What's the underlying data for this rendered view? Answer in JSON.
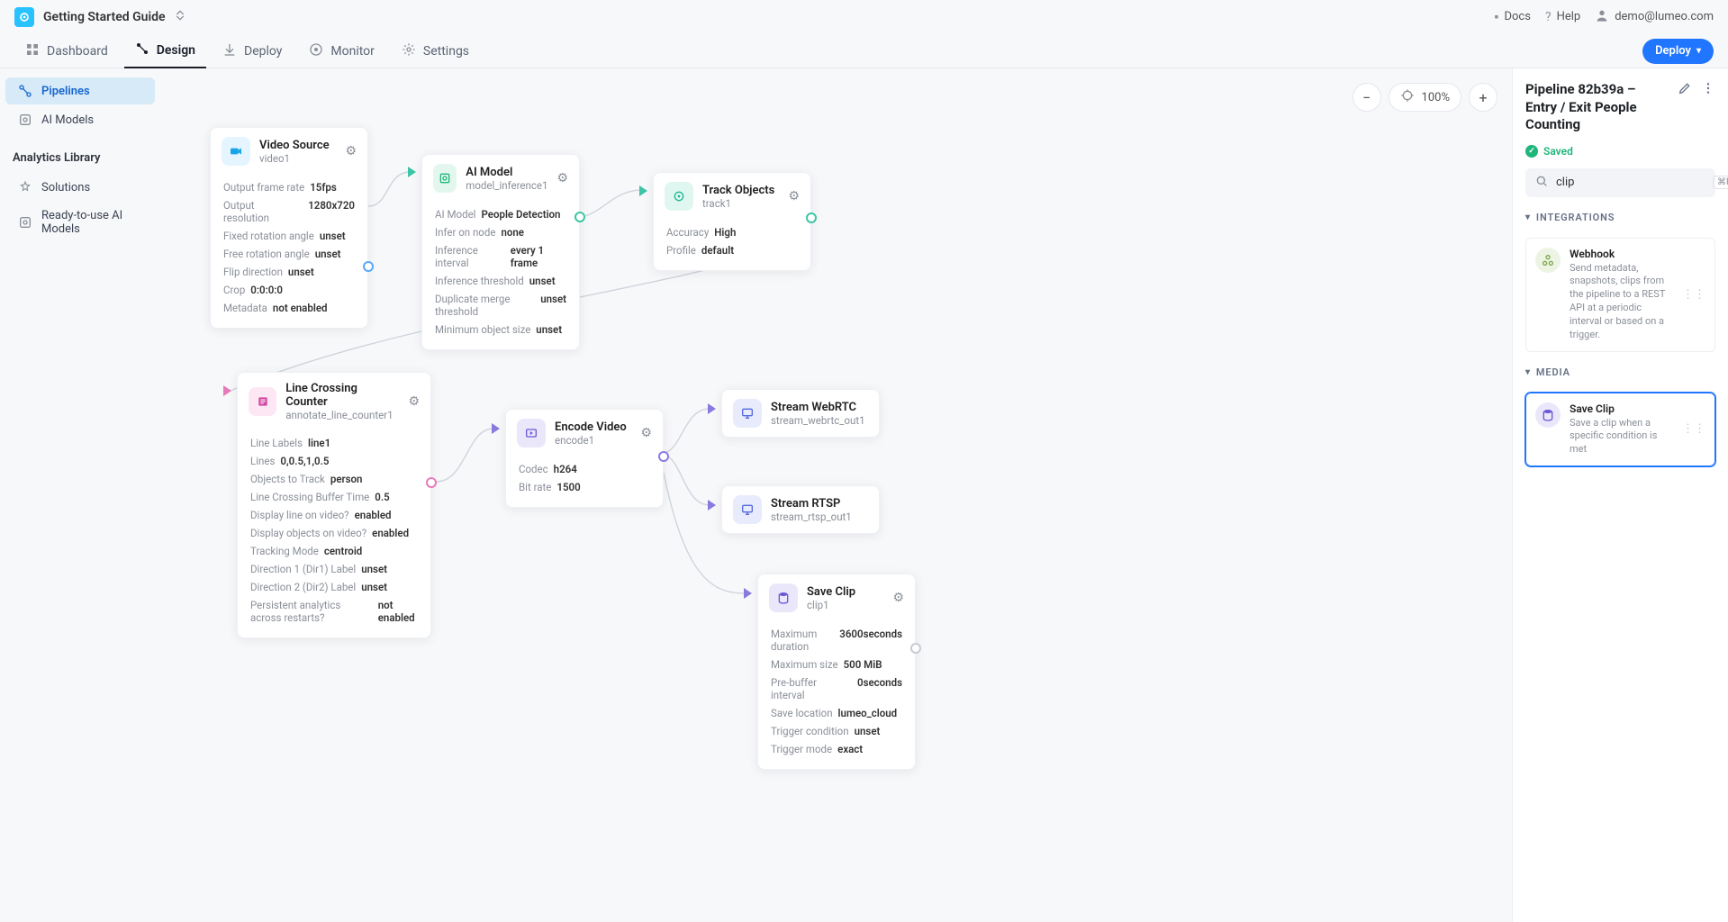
{
  "project_name": "Getting Started Guide",
  "top_links": {
    "docs": "Docs",
    "help": "Help",
    "user": "demo@lumeo.com"
  },
  "tabs": {
    "dashboard": "Dashboard",
    "design": "Design",
    "deploy": "Deploy",
    "monitor": "Monitor",
    "settings": "Settings"
  },
  "deploy_btn": "Deploy",
  "sidebar": {
    "pipelines": "Pipelines",
    "ai_models": "AI Models",
    "library_heading": "Analytics Library",
    "solutions": "Solutions",
    "ready_models": "Ready-to-use AI Models"
  },
  "zoom": {
    "level": "100%"
  },
  "nodes": {
    "video_source": {
      "title": "Video Source",
      "sub": "video1",
      "props": [
        {
          "k": "Output frame rate",
          "v": "15fps"
        },
        {
          "k": "Output resolution",
          "v": "1280x720"
        },
        {
          "k": "Fixed rotation angle",
          "v": "unset"
        },
        {
          "k": "Free rotation angle",
          "v": "unset"
        },
        {
          "k": "Flip direction",
          "v": "unset"
        },
        {
          "k": "Crop",
          "v": "0:0:0:0"
        },
        {
          "k": "Metadata",
          "v": "not enabled"
        }
      ]
    },
    "ai_model": {
      "title": "AI Model",
      "sub": "model_inference1",
      "props": [
        {
          "k": "AI Model",
          "v": "People Detection"
        },
        {
          "k": "Infer on node",
          "v": "none"
        },
        {
          "k": "Inference interval",
          "v": "every 1 frame"
        },
        {
          "k": "Inference threshold",
          "v": "unset"
        },
        {
          "k": "Duplicate merge threshold",
          "v": "unset"
        },
        {
          "k": "Minimum object size",
          "v": "unset"
        }
      ]
    },
    "track_objects": {
      "title": "Track Objects",
      "sub": "track1",
      "props": [
        {
          "k": "Accuracy",
          "v": "High"
        },
        {
          "k": "Profile",
          "v": "default"
        }
      ]
    },
    "line_counter": {
      "title": "Line Crossing Counter",
      "sub": "annotate_line_counter1",
      "props": [
        {
          "k": "Line Labels",
          "v": "line1"
        },
        {
          "k": "Lines",
          "v": "0,0.5,1,0.5"
        },
        {
          "k": "Objects to Track",
          "v": "person"
        },
        {
          "k": "Line Crossing Buffer Time",
          "v": "0.5"
        },
        {
          "k": "Display line on video?",
          "v": "enabled"
        },
        {
          "k": "Display objects on video?",
          "v": "enabled"
        },
        {
          "k": "Tracking Mode",
          "v": "centroid"
        },
        {
          "k": "Direction 1 (Dir1) Label",
          "v": "unset"
        },
        {
          "k": "Direction 2 (Dir2) Label",
          "v": "unset"
        },
        {
          "k": "Persistent analytics across restarts?",
          "v": "not enabled"
        }
      ]
    },
    "encode": {
      "title": "Encode Video",
      "sub": "encode1",
      "props": [
        {
          "k": "Codec",
          "v": "h264"
        },
        {
          "k": "Bit rate",
          "v": "1500"
        }
      ]
    },
    "webrtc": {
      "title": "Stream WebRTC",
      "sub": "stream_webrtc_out1"
    },
    "rtsp": {
      "title": "Stream RTSP",
      "sub": "stream_rtsp_out1"
    },
    "save_clip": {
      "title": "Save Clip",
      "sub": "clip1",
      "props": [
        {
          "k": "Maximum duration",
          "v": "3600seconds"
        },
        {
          "k": "Maximum size",
          "v": "500 MiB"
        },
        {
          "k": "Pre-buffer interval",
          "v": "0seconds"
        },
        {
          "k": "Save location",
          "v": "lumeo_cloud"
        },
        {
          "k": "Trigger condition",
          "v": "unset"
        },
        {
          "k": "Trigger mode",
          "v": "exact"
        }
      ]
    }
  },
  "right_panel": {
    "title": "Pipeline 82b39a – Entry / Exit People Counting",
    "status": "Saved",
    "search_value": "clip",
    "search_shortcut": "⌘F",
    "sections": {
      "integrations": "INTEGRATIONS",
      "media": "MEDIA"
    },
    "cards": {
      "webhook": {
        "title": "Webhook",
        "desc": "Send metadata, snapshots, clips from the pipeline to a REST API at a periodic interval or based on a trigger."
      },
      "save_clip": {
        "title": "Save Clip",
        "desc": "Save a clip when a specific condition is met"
      }
    }
  }
}
